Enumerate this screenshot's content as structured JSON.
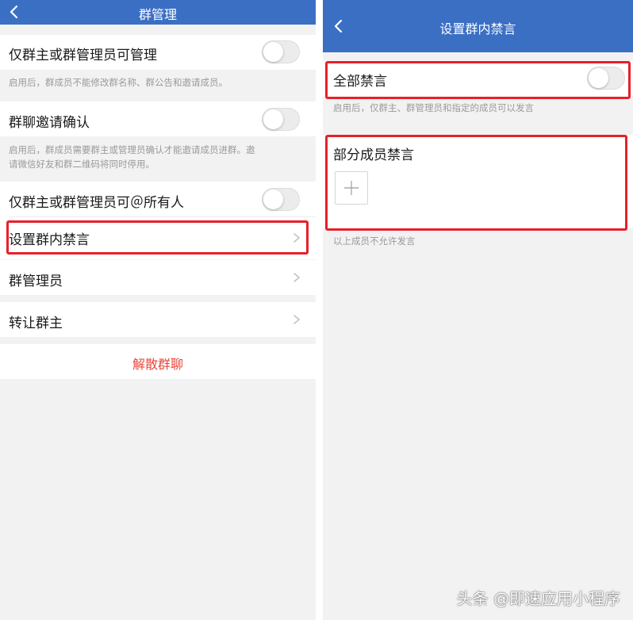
{
  "left": {
    "title": "群管理",
    "rows": {
      "owner_admin_manage": {
        "label": "仅群主或群管理员可管理",
        "toggle_on": false
      },
      "owner_admin_manage_note": "启用后，群成员不能修改群名称、群公告和邀请成员。",
      "invite_confirm": {
        "label": "群聊邀请确认",
        "toggle_on": false
      },
      "invite_confirm_note_line1": "启用后，群成员需要群主或管理员确认才能邀请成员进群。邀",
      "invite_confirm_note_line2": "请微信好友和群二维码将同时停用。",
      "at_all": {
        "label": "仅群主或群管理员可＠所有人",
        "toggle_on": false
      },
      "mute_settings": {
        "label": "设置群内禁言"
      },
      "group_admins": {
        "label": "群管理员"
      },
      "transfer_owner": {
        "label": "转让群主"
      }
    },
    "dissolve_label": "解散群聊"
  },
  "right": {
    "title": "设置群内禁言",
    "mute_all": {
      "label": "全部禁言",
      "toggle_on": false
    },
    "mute_all_note": "启用后，仅群主、群管理员和指定的成员可以发言",
    "partial_mute": {
      "label": "部分成员禁言"
    },
    "partial_note": "以上成员不允许发言"
  },
  "watermark": "头条 @即速应用小程序",
  "colors": {
    "navbar": "#3b6fc4",
    "highlight_border": "#e8202a",
    "danger_text": "#e8463a",
    "background": "#f2f2f2"
  },
  "icons": {
    "back": "chevron-left-icon",
    "disclosure": "chevron-right-icon",
    "add": "plus-icon"
  }
}
